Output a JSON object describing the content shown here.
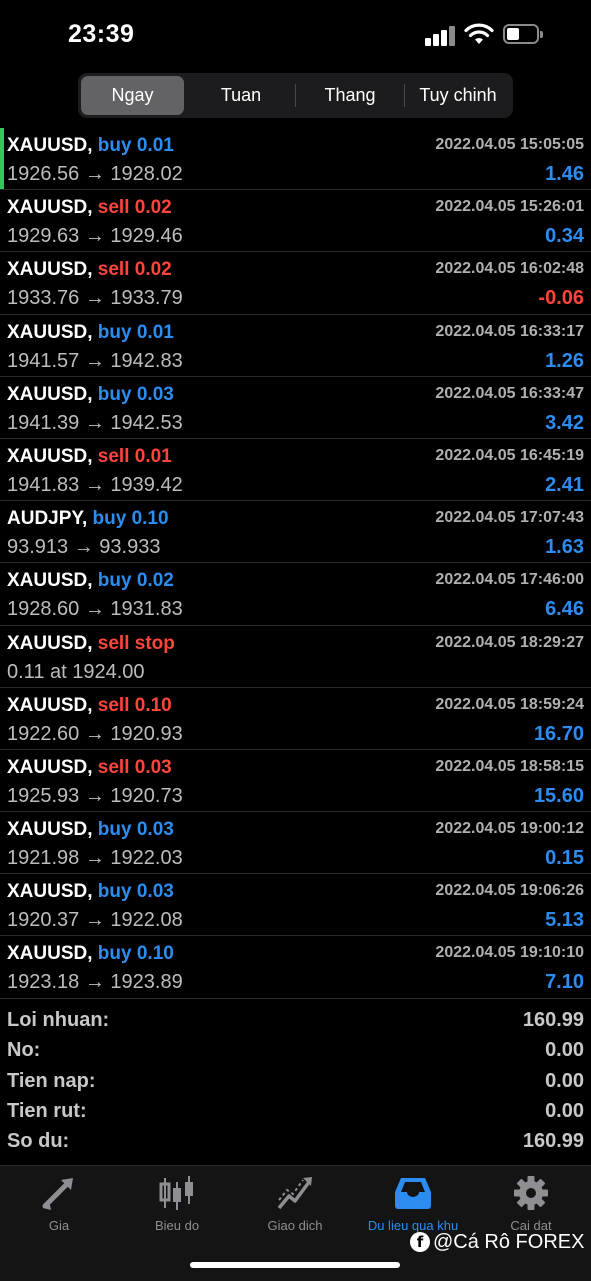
{
  "status_bar": {
    "time": "23:39"
  },
  "tabs": [
    {
      "label": "Ngay",
      "active": true
    },
    {
      "label": "Tuan",
      "active": false
    },
    {
      "label": "Thang",
      "active": false
    },
    {
      "label": "Tuy chinh",
      "active": false
    }
  ],
  "deals": [
    {
      "symbol": "XAUUSD,",
      "side": "buy",
      "volume": "buy 0.01",
      "time": "2022.04.05 15:05:05",
      "prices": "1926.56 → 1928.02",
      "profit": "1.46"
    },
    {
      "symbol": "XAUUSD,",
      "side": "sell",
      "volume": "sell 0.02",
      "time": "2022.04.05 15:26:01",
      "prices": "1929.63 → 1929.46",
      "profit": "0.34"
    },
    {
      "symbol": "XAUUSD,",
      "side": "sell",
      "volume": "sell 0.02",
      "time": "2022.04.05 16:02:48",
      "prices": "1933.76 → 1933.79",
      "profit": "-0.06"
    },
    {
      "symbol": "XAUUSD,",
      "side": "buy",
      "volume": "buy 0.01",
      "time": "2022.04.05 16:33:17",
      "prices": "1941.57 → 1942.83",
      "profit": "1.26"
    },
    {
      "symbol": "XAUUSD,",
      "side": "buy",
      "volume": "buy 0.03",
      "time": "2022.04.05 16:33:47",
      "prices": "1941.39 → 1942.53",
      "profit": "3.42"
    },
    {
      "symbol": "XAUUSD,",
      "side": "sell",
      "volume": "sell 0.01",
      "time": "2022.04.05 16:45:19",
      "prices": "1941.83 → 1939.42",
      "profit": "2.41"
    },
    {
      "symbol": "AUDJPY,",
      "side": "buy",
      "volume": "buy 0.10",
      "time": "2022.04.05 17:07:43",
      "prices": "93.913 → 93.933",
      "profit": "1.63"
    },
    {
      "symbol": "XAUUSD,",
      "side": "buy",
      "volume": "buy 0.02",
      "time": "2022.04.05 17:46:00",
      "prices": "1928.60 → 1931.83",
      "profit": "6.46"
    },
    {
      "symbol": "XAUUSD,",
      "side": "sell",
      "volume": "sell stop",
      "time": "2022.04.05 18:29:27",
      "prices": "0.11 at 1924.00",
      "profit": ""
    },
    {
      "symbol": "XAUUSD,",
      "side": "sell",
      "volume": "sell 0.10",
      "time": "2022.04.05 18:59:24",
      "prices": "1922.60 → 1920.93",
      "profit": "16.70"
    },
    {
      "symbol": "XAUUSD,",
      "side": "sell",
      "volume": "sell 0.03",
      "time": "2022.04.05 18:58:15",
      "prices": "1925.93 → 1920.73",
      "profit": "15.60"
    },
    {
      "symbol": "XAUUSD,",
      "side": "buy",
      "volume": "buy 0.03",
      "time": "2022.04.05 19:00:12",
      "prices": "1921.98 → 1922.03",
      "profit": "0.15"
    },
    {
      "symbol": "XAUUSD,",
      "side": "buy",
      "volume": "buy 0.03",
      "time": "2022.04.05 19:06:26",
      "prices": "1920.37 → 1922.08",
      "profit": "5.13"
    },
    {
      "symbol": "XAUUSD,",
      "side": "buy",
      "volume": "buy 0.10",
      "time": "2022.04.05 19:10:10",
      "prices": "1923.18 → 1923.89",
      "profit": "7.10"
    }
  ],
  "summary": [
    {
      "label": "Loi nhuan:",
      "value": "160.99"
    },
    {
      "label": "No:",
      "value": "0.00"
    },
    {
      "label": "Tien nap:",
      "value": "0.00"
    },
    {
      "label": "Tien rut:",
      "value": "0.00"
    },
    {
      "label": "So du:",
      "value": "160.99"
    }
  ],
  "bottom_nav": [
    {
      "label": "Gia",
      "icon": "quotes-arrows-icon",
      "active": false
    },
    {
      "label": "Bieu do",
      "icon": "candlestick-chart-icon",
      "active": false
    },
    {
      "label": "Giao dich",
      "icon": "trade-line-icon",
      "active": false
    },
    {
      "label": "Du lieu qua khu",
      "icon": "history-tray-icon",
      "active": true
    },
    {
      "label": "Cai dat",
      "icon": "gear-icon",
      "active": false
    }
  ],
  "watermark": {
    "logo": "f",
    "text": "@Cá Rô FOREX"
  },
  "colors": {
    "buy": "#2d8cf0",
    "sell": "#ff453a",
    "accent_bar": "#34c759",
    "background": "#000000"
  }
}
